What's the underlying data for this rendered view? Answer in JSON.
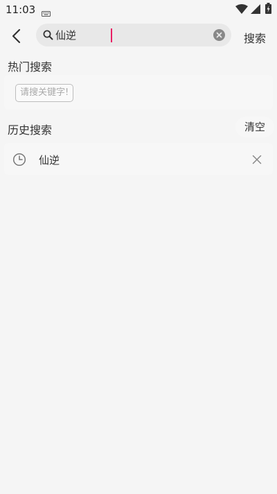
{
  "status_bar": {
    "time": "11:03",
    "icons": [
      "keyboard-icon",
      "wifi-icon",
      "signal-icon",
      "battery-icon"
    ]
  },
  "search": {
    "value": "仙逆",
    "submit_label": "搜索",
    "back_icon": "chevron-left-icon",
    "clear_icon": "close-circle-icon"
  },
  "hot_search": {
    "title": "热门搜索",
    "chips": [
      "请搜关键字!"
    ]
  },
  "history": {
    "title": "历史搜索",
    "clear_label": "清空",
    "items": [
      {
        "text": "仙逆",
        "icon": "clock-icon",
        "delete_icon": "close-icon"
      }
    ]
  },
  "colors": {
    "background": "#f5f5f5",
    "search_box": "#e8e8e8",
    "cursor": "#e91e63",
    "chip_border": "#bdbdbd",
    "chip_text": "#aaaaaa"
  }
}
